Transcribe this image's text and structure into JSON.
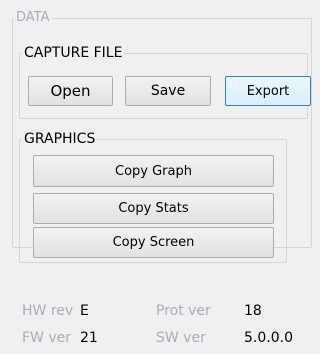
{
  "data_group": {
    "title": "DATA"
  },
  "capture_file": {
    "title": "CAPTURE FILE",
    "open_label": "Open",
    "save_label": "Save",
    "export_label": "Export"
  },
  "graphics": {
    "title": "GRAPHICS",
    "copy_graph_label": "Copy Graph",
    "copy_stats_label": "Copy Stats",
    "copy_screen_label": "Copy Screen"
  },
  "info": {
    "hw_rev_label": "HW rev",
    "hw_rev_value": "E",
    "fw_ver_label": "FW ver",
    "fw_ver_value": "21",
    "prot_ver_label": "Prot ver",
    "prot_ver_value": "18",
    "sw_ver_label": "SW ver",
    "sw_ver_value": "5.0.0.0"
  }
}
